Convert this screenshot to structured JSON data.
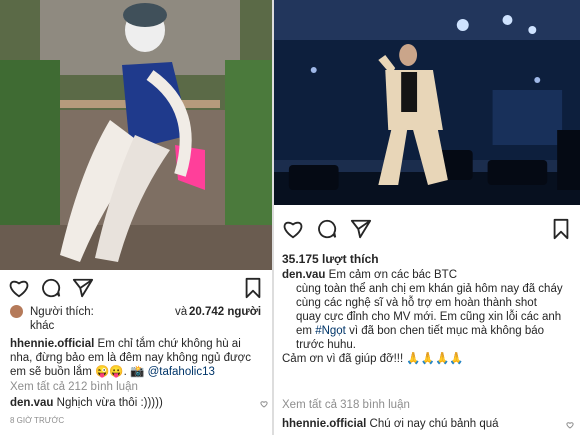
{
  "left_post": {
    "likes_prefix": "Người thích:",
    "likes_name": "khác",
    "likes_and": "và",
    "likes_count": "20.742 người",
    "caption_user": "hhennie.official",
    "caption_text": "Em chỉ tắm chứ không hù ai nha, đừng bảo em là đêm nay không ngủ được em sẽ buồn lắm 😜😛. 📸",
    "caption_tag": "@tafaholic13",
    "view_all": "Xem tất cả 212 bình luận",
    "comment_user": "den.vau",
    "comment_text": "Nghịch vừa thôi :)))))",
    "time": "8 GIỜ TRƯỚC"
  },
  "right_post": {
    "likes": "35.175 lượt thích",
    "caption_user": "den.vau",
    "caption_line1": "Em cảm ơn các bác BTC",
    "caption_line2": "cùng toàn thể anh chị em khán giả hôm nay đã cháy cùng các nghệ sĩ và hỗ trợ em hoàn thành shot quay cực đỉnh cho MV mới. Em cũng xin lỗi các anh em",
    "caption_tag": "#Ngọt",
    "caption_line3": "vì đã bon chen tiết mục mà không báo trước huhu.",
    "caption_line4": "Cảm ơn vì đã giúp đỡ!!! 🙏🙏🙏🙏",
    "view_all": "Xem tất cả 318 bình luận",
    "comment_user": "hhennie.official",
    "comment_text": "Chú ơi nay chú bảnh quá"
  },
  "icons": [
    "heart-icon",
    "comment-icon",
    "share-icon",
    "bookmark-icon"
  ]
}
